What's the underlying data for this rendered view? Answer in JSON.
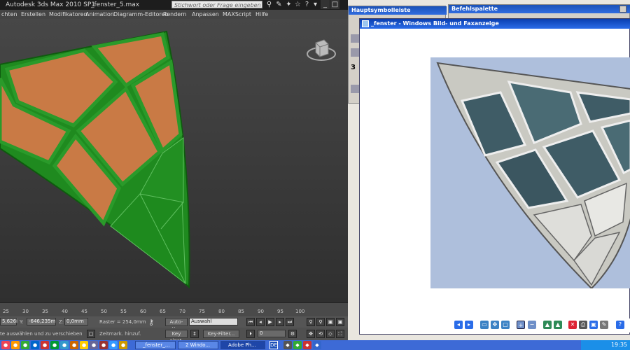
{
  "max_window": {
    "app_title": "Autodesk 3ds Max  2010 SP1",
    "file_title": "_fenster_5.max",
    "search_placeholder": "Stichwort oder Frage eingeben",
    "menu": [
      "chten",
      "Erstellen",
      "Modifikatoren",
      "Animation",
      "Diagramm-Editoren",
      "Rendern",
      "Anpassen",
      "MAXScript",
      "Hilfe"
    ],
    "timeline_ticks": [
      "25",
      "30",
      "35",
      "40",
      "45",
      "50",
      "55",
      "60",
      "65",
      "70",
      "75",
      "80",
      "85",
      "90",
      "95",
      "100"
    ],
    "status": {
      "x_value": "5,626i",
      "y_label": "Y:",
      "y_value": "-646,235m",
      "z_label": "Z:",
      "z_value": "0,0mm",
      "grid": "Raster = 254,0mm",
      "autokey_label": "Auto-Key",
      "selection_value": "Auswahl",
      "keyset_label": "Key einst.",
      "keyfilter_label": "Key-Filter...",
      "frame_value": "0",
      "prompt": "te auswählen und zu verschieben",
      "timemark": "Zeitmark. hinzuf."
    }
  },
  "panels": {
    "haupt_title": "Hauptsymbolleiste",
    "befehl_title": "Befehlspalette",
    "haupt_digit": "3"
  },
  "fax_viewer": {
    "title": "_fenster - Windows Bild- und Faxanzeige"
  },
  "taskbar": {
    "tasks": [
      {
        "label": "_fenster_...",
        "active": false
      },
      {
        "label": "2 Windo...",
        "active": false
      },
      {
        "label": "Adobe Ph...",
        "active": true
      }
    ],
    "language": "DE",
    "clock": "19:35"
  },
  "colors": {
    "mesh_green": "#1f8a1f",
    "glass_orange": "#c97a45",
    "title_blue": "#2a6ce8"
  }
}
